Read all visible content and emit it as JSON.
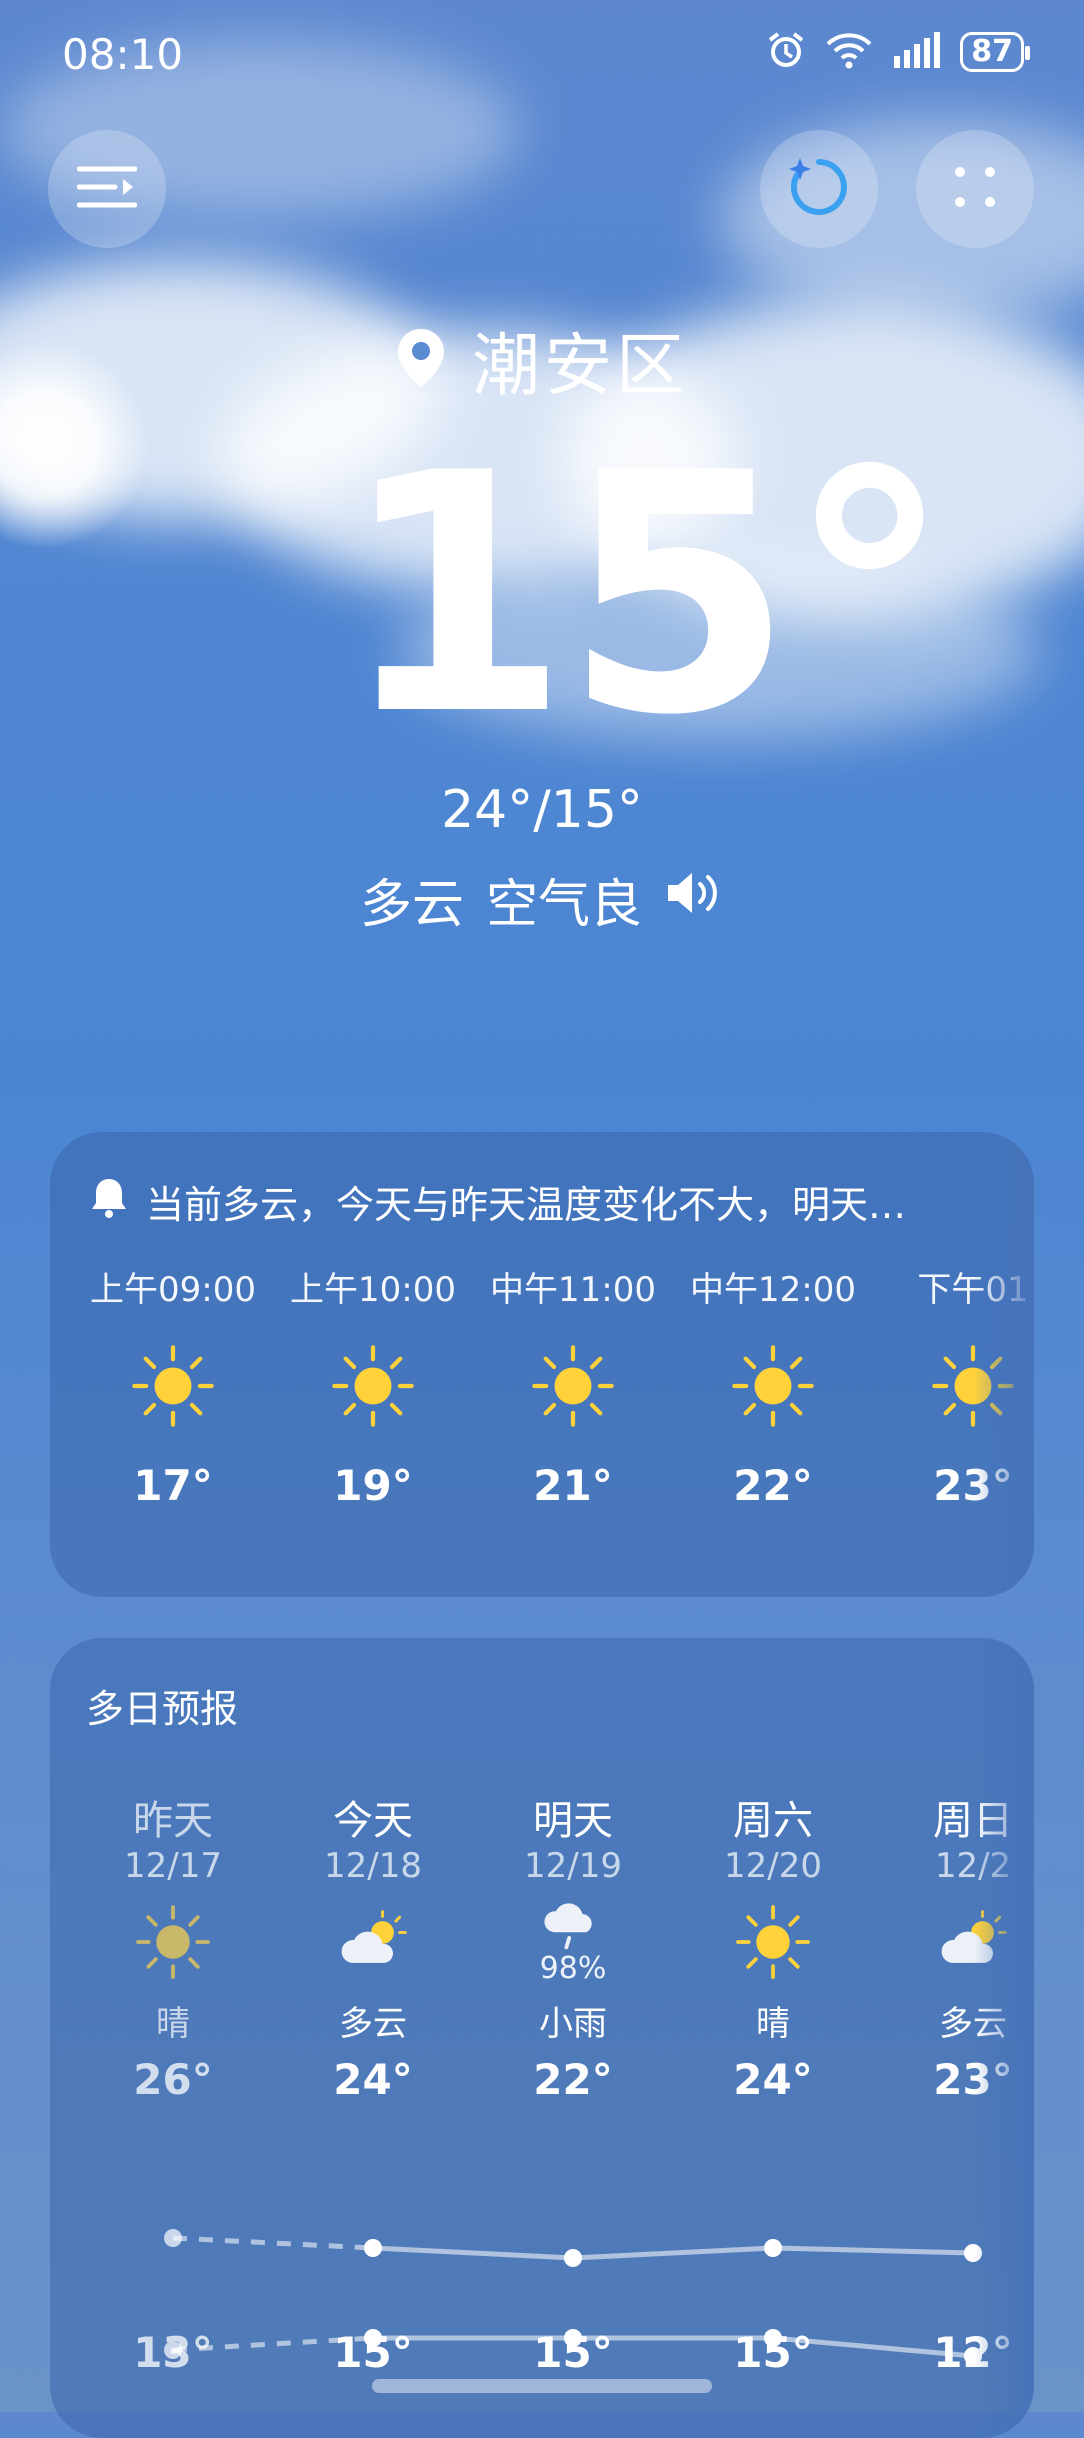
{
  "status_bar": {
    "time": "08:10",
    "battery": "87"
  },
  "location": {
    "name": "潮安区"
  },
  "current": {
    "temp": "15°",
    "hilo": "24°/15°",
    "condition": "多云",
    "air": "空气良"
  },
  "hourly_card": {
    "alert": "当前多云，今天与昨天温度变化不大，明天…",
    "hours": [
      {
        "time": "上午09:00",
        "icon": "sun-icon",
        "temp": "17°"
      },
      {
        "time": "上午10:00",
        "icon": "sun-icon",
        "temp": "19°"
      },
      {
        "time": "中午11:00",
        "icon": "sun-icon",
        "temp": "21°"
      },
      {
        "time": "中午12:00",
        "icon": "sun-icon",
        "temp": "22°"
      },
      {
        "time": "下午01",
        "icon": "sun-icon",
        "temp": "23°"
      }
    ]
  },
  "daily_card": {
    "title": "多日预报",
    "days": [
      {
        "name": "昨天",
        "date": "12/17",
        "icon": "sun-icon",
        "pct": "",
        "cond": "晴",
        "high": "26°",
        "low": "13°"
      },
      {
        "name": "今天",
        "date": "12/18",
        "icon": "partly-cloudy-icon",
        "pct": "",
        "cond": "多云",
        "high": "24°",
        "low": "15°"
      },
      {
        "name": "明天",
        "date": "12/19",
        "icon": "light-rain-icon",
        "pct": "98%",
        "cond": "小雨",
        "high": "22°",
        "low": "15°"
      },
      {
        "name": "周六",
        "date": "12/20",
        "icon": "sun-icon",
        "pct": "",
        "cond": "晴",
        "high": "24°",
        "low": "15°"
      },
      {
        "name": "周日",
        "date": "12/2",
        "icon": "partly-cloudy-icon",
        "pct": "",
        "cond": "多云",
        "high": "23°",
        "low": "12°"
      }
    ]
  },
  "colors": {
    "sun": "#ffd23a",
    "accent_blue": "#4a86d6"
  }
}
